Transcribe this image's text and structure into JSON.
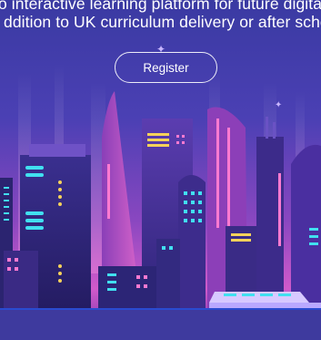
{
  "hero": {
    "tagline_line1": "o interactive learning platform for future digital",
    "tagline_line2": "ddition to UK curriculum delivery or after schoo",
    "register_label": "Register"
  },
  "illustration": {
    "subject": "futuristic-city-skyline",
    "colors": {
      "sky_top": "#3b3aa3",
      "glow": "#d05acb",
      "building_dark": "#2b2470",
      "window_cyan": "#41e0f0",
      "window_yellow": "#f7d25a",
      "accent_pink": "#ff7ad1"
    }
  }
}
